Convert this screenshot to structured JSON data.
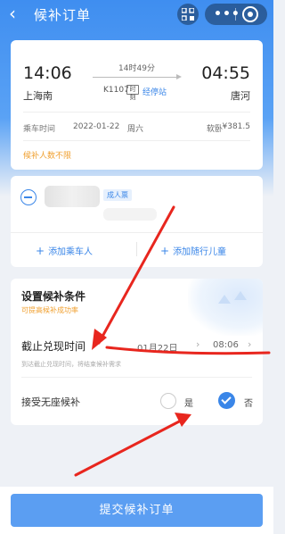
{
  "header": {
    "title": "候补订单"
  },
  "colors": {
    "accent": "#3a86e8",
    "annotation": "#e8261e",
    "hint_orange": "#f0a030"
  },
  "train": {
    "departure_time": "14:06",
    "arrival_time": "04:55",
    "departure_station": "上海南",
    "arrival_station": "唐河",
    "duration": "14时49分",
    "train_number": "K1107",
    "timetable_badge": "时刻",
    "stops_link": "经停站",
    "date_label": "乘车时间",
    "date": "2022-01-22",
    "weekday": "周六",
    "seat_type": "软卧",
    "price": "¥381.5",
    "hint": "候补人数不限"
  },
  "passengers": {
    "ticket_badge": "成人票",
    "add_passenger": "添加乘车人",
    "add_child": "添加随行儿童"
  },
  "conditions": {
    "title": "设置候补条件",
    "subtitle": "可提高候补成功率",
    "deadline_label": "截止兑现时间",
    "deadline_date": "01月22日",
    "deadline_time": "08:06",
    "deadline_hint": "到达截止兑现时间，将结束候补需求",
    "no_seat_label": "接受无座候补",
    "option_yes": "是",
    "option_no": "否",
    "selected": "否"
  },
  "footer": {
    "submit_label": "提交候补订单"
  }
}
